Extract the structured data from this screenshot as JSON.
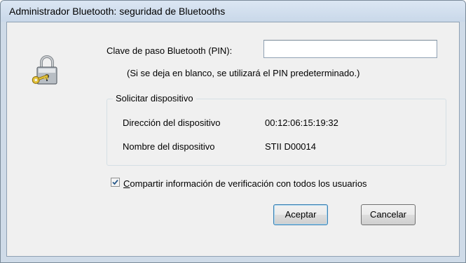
{
  "window": {
    "title": "Administrador Bluetooth: seguridad de Bluetooths"
  },
  "pin": {
    "label": "Clave de paso Bluetooth (PIN):",
    "value": "",
    "hint": "(Si se deja en blanco, se utilizará el PIN predeterminado.)"
  },
  "device_group": {
    "legend": "Solicitar dispositivo",
    "address_label": "Dirección del dispositivo",
    "address_value": "00:12:06:15:19:32",
    "name_label": "Nombre del dispositivo",
    "name_value": "STII D00014"
  },
  "share": {
    "checked": true,
    "label_mnemonic": "C",
    "label_rest": "ompartir información de verificación con todos los usuarios"
  },
  "buttons": {
    "ok": "Aceptar",
    "cancel": "Cancelar"
  },
  "icons": {
    "lock": "padlock-key-icon",
    "check": "checkmark-icon"
  }
}
